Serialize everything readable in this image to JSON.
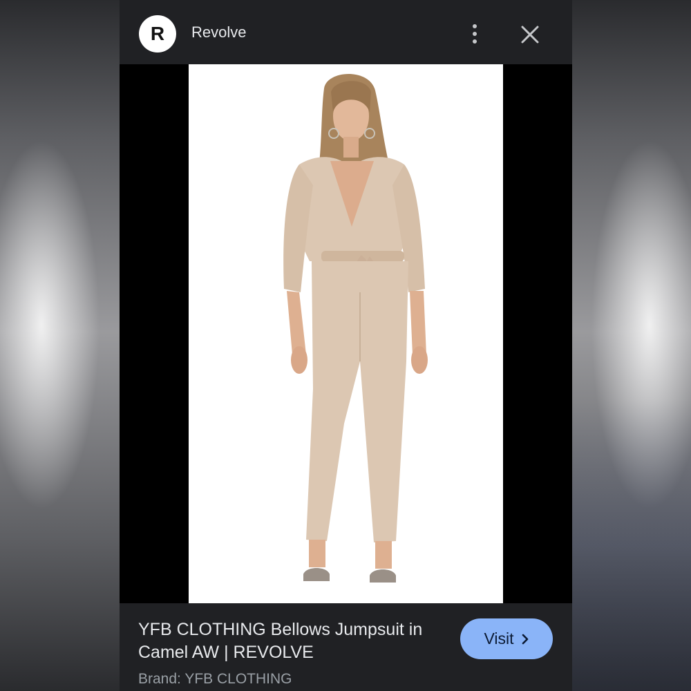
{
  "header": {
    "logo_letter": "R",
    "site_name": "Revolve",
    "more_icon": "more-vert-icon",
    "close_icon": "close-icon"
  },
  "product": {
    "title": "YFB CLOTHING Bellows Jumpsuit in Camel AW | REVOLVE",
    "brand": "Brand: YFB CLOTHING"
  },
  "actions": {
    "visit_label": "Visit",
    "visit_icon": "chevron-right-icon"
  },
  "colors": {
    "panel_bg": "#202124",
    "visit_button": "#8ab4f8",
    "garment": "#dcc7b2"
  }
}
